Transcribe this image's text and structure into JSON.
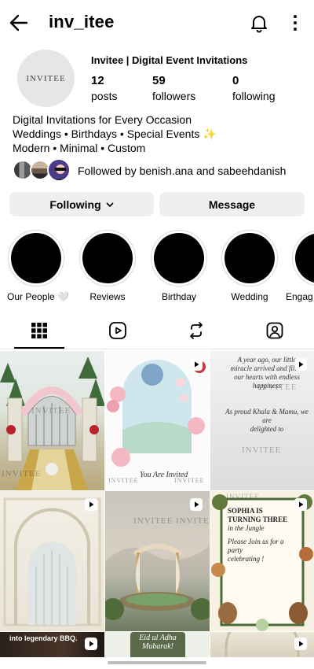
{
  "header": {
    "username": "inv_itee",
    "icons": [
      "back-arrow-icon",
      "bell-icon",
      "more-vertical-icon"
    ]
  },
  "profile": {
    "avatar_text": "INVITEE",
    "display_name": "Invitee | Digital Event Invitations",
    "stats": [
      {
        "value": "12",
        "label": "posts"
      },
      {
        "value": "59",
        "label": "followers"
      },
      {
        "value": "0",
        "label": "following"
      }
    ],
    "bio": [
      "Digital Invitations for Every Occasion",
      "Weddings • Birthdays • Special Events ✨",
      "Modern • Minimal • Custom"
    ],
    "followed_by": "Followed by benish.ana and sabeehdanish"
  },
  "actions": {
    "following_label": "Following",
    "message_label": "Message"
  },
  "highlights": [
    {
      "label": "Our People 🤍"
    },
    {
      "label": "Reviews"
    },
    {
      "label": "Birthday"
    },
    {
      "label": "Wedding"
    },
    {
      "label": "Engag"
    }
  ],
  "tabs": [
    "grid-icon",
    "reels-icon",
    "repost-icon",
    "tagged-icon"
  ],
  "posts": {
    "watermark": "INVITEE",
    "post2_caption": "You Are Invited",
    "post3_text": [
      "A year ago, our little",
      "miracle arrived and filled",
      "our hearts with endless happiness",
      "As proud Khala & Mamu, we are",
      "delighted to"
    ],
    "post6_text": [
      "SOPHIA IS",
      "TURNING THREE",
      "in the Jungle",
      "Please Join us for a party",
      "celebrating !"
    ],
    "post7_caption": "into legendary BBQ.",
    "post8_text": [
      "Eid ul Adha",
      "Mubarak!"
    ]
  },
  "colors": {
    "button_bg": "#efefef",
    "text": "#000000"
  }
}
